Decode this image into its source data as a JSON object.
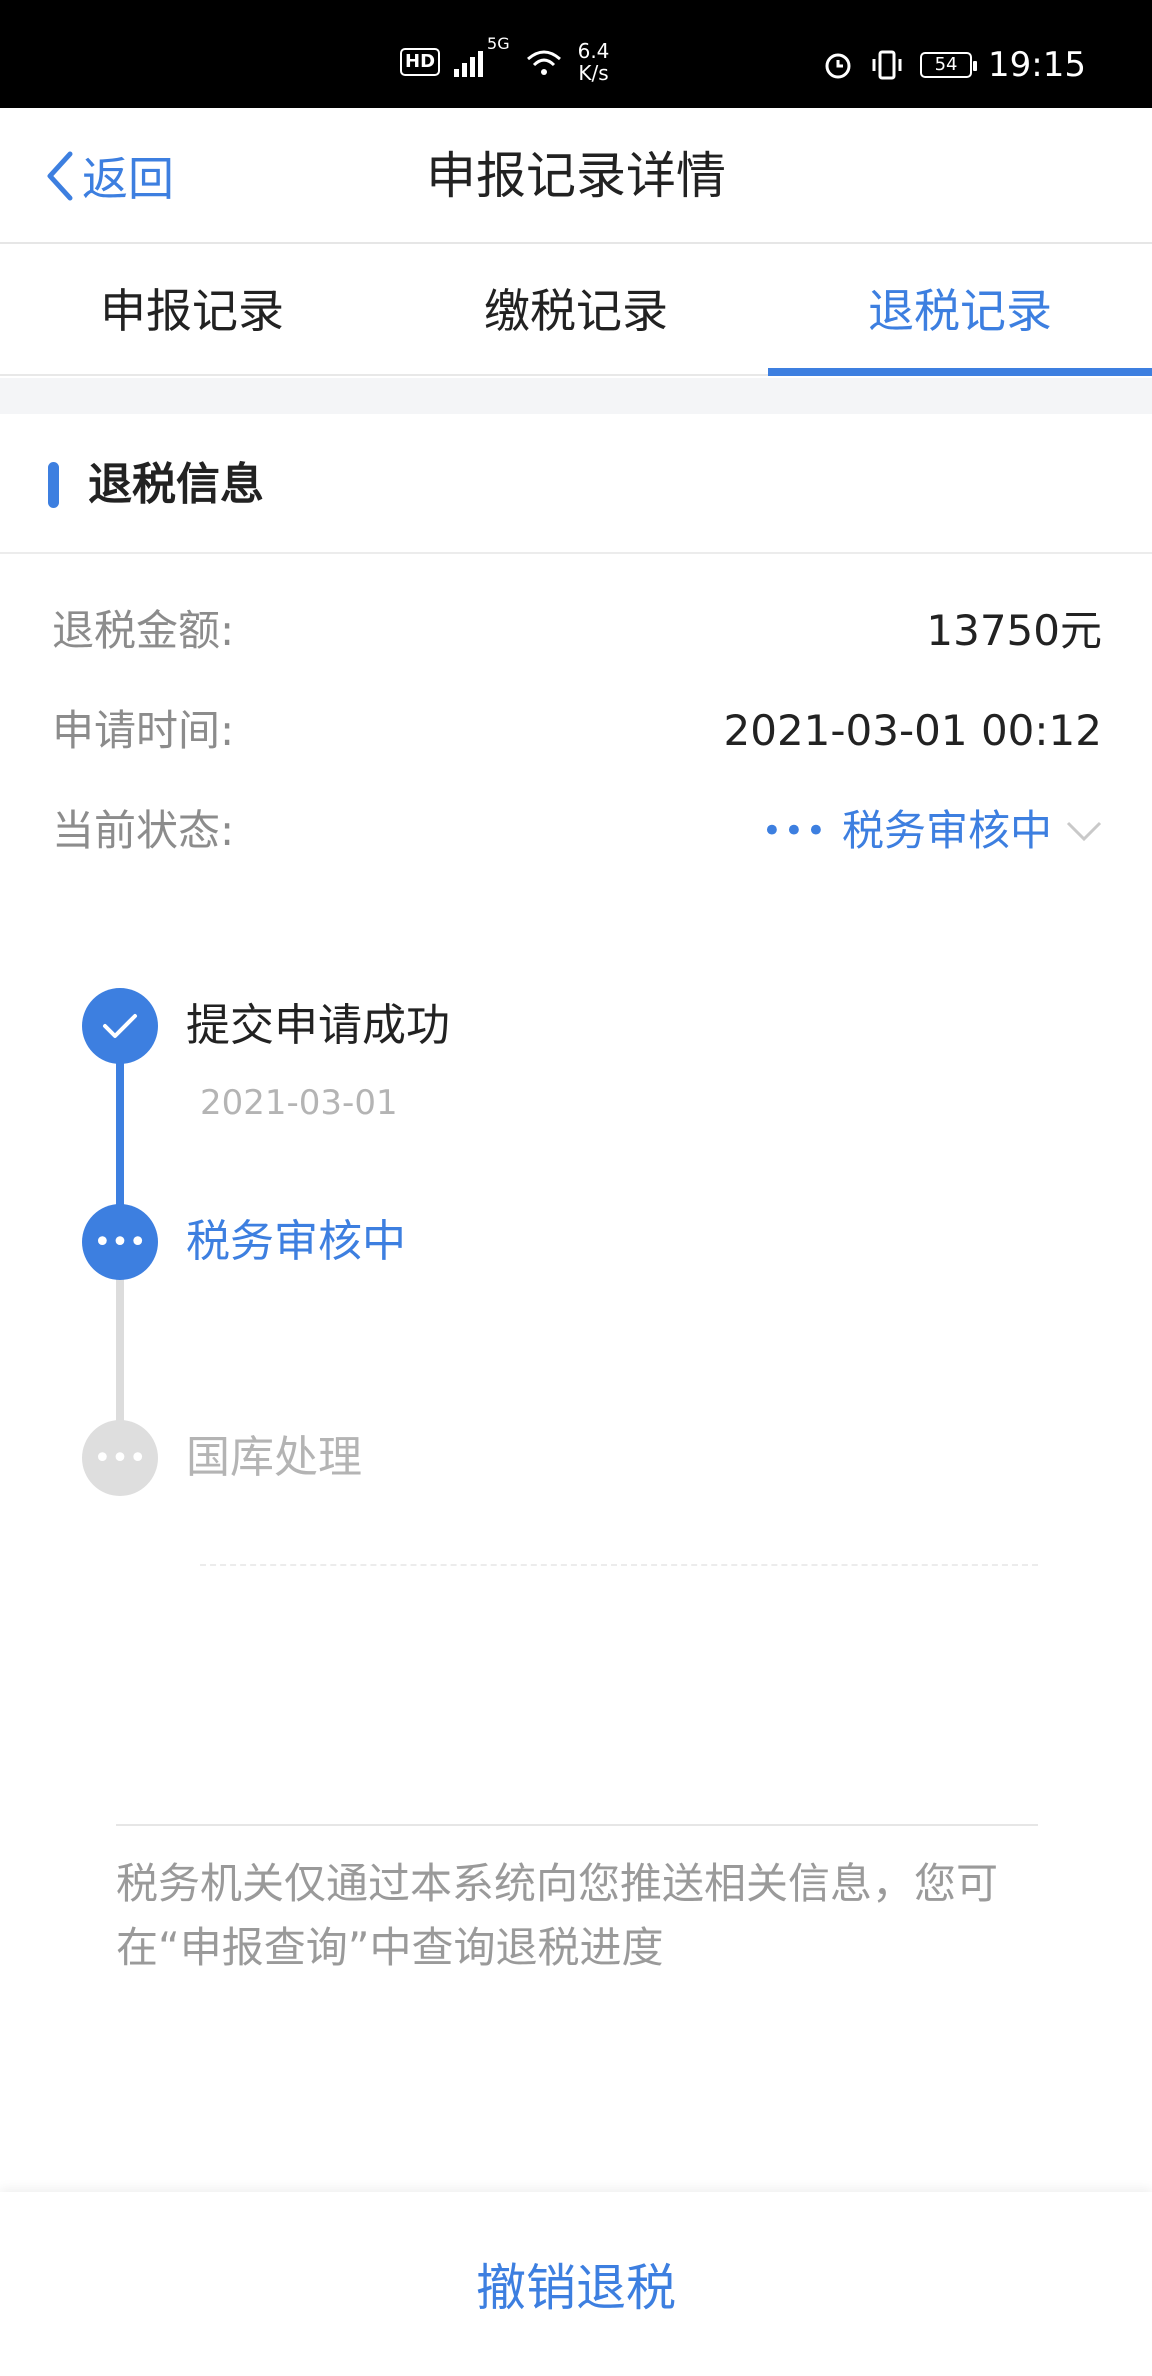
{
  "status_bar": {
    "hd_badge": "HD",
    "network_type": "5G",
    "speed_value": "6.4",
    "speed_unit": "K/s",
    "battery_level": "54",
    "time": "19:15",
    "icons": [
      "signal-icon",
      "wifi-icon",
      "alarm-icon",
      "vibrate-icon",
      "battery-icon"
    ]
  },
  "navbar": {
    "back_label": "返回",
    "title": "申报记录详情"
  },
  "tabs": [
    {
      "label": "申报记录",
      "active": false
    },
    {
      "label": "缴税记录",
      "active": false
    },
    {
      "label": "退税记录",
      "active": true
    }
  ],
  "section": {
    "title": "退税信息"
  },
  "info": {
    "amount_label": "退税金额:",
    "amount_value": "13750元",
    "time_label": "申请时间:",
    "time_value": "2021-03-01 00:12",
    "status_label": "当前状态:",
    "status_value": "税务审核中"
  },
  "timeline": [
    {
      "label": "提交申请成功",
      "date": "2021-03-01",
      "state": "done"
    },
    {
      "label": "税务审核中",
      "date": "",
      "state": "current"
    },
    {
      "label": "国库处理",
      "date": "",
      "state": "pending"
    }
  ],
  "note": "税务机关仅通过本系统向您推送相关信息，您可在“申报查询”中查询退税进度",
  "bottom": {
    "cancel_label": "撤销退税"
  },
  "colors": {
    "accent": "#3d7fe0",
    "muted": "#8c8c8c",
    "pending": "#dedede"
  }
}
